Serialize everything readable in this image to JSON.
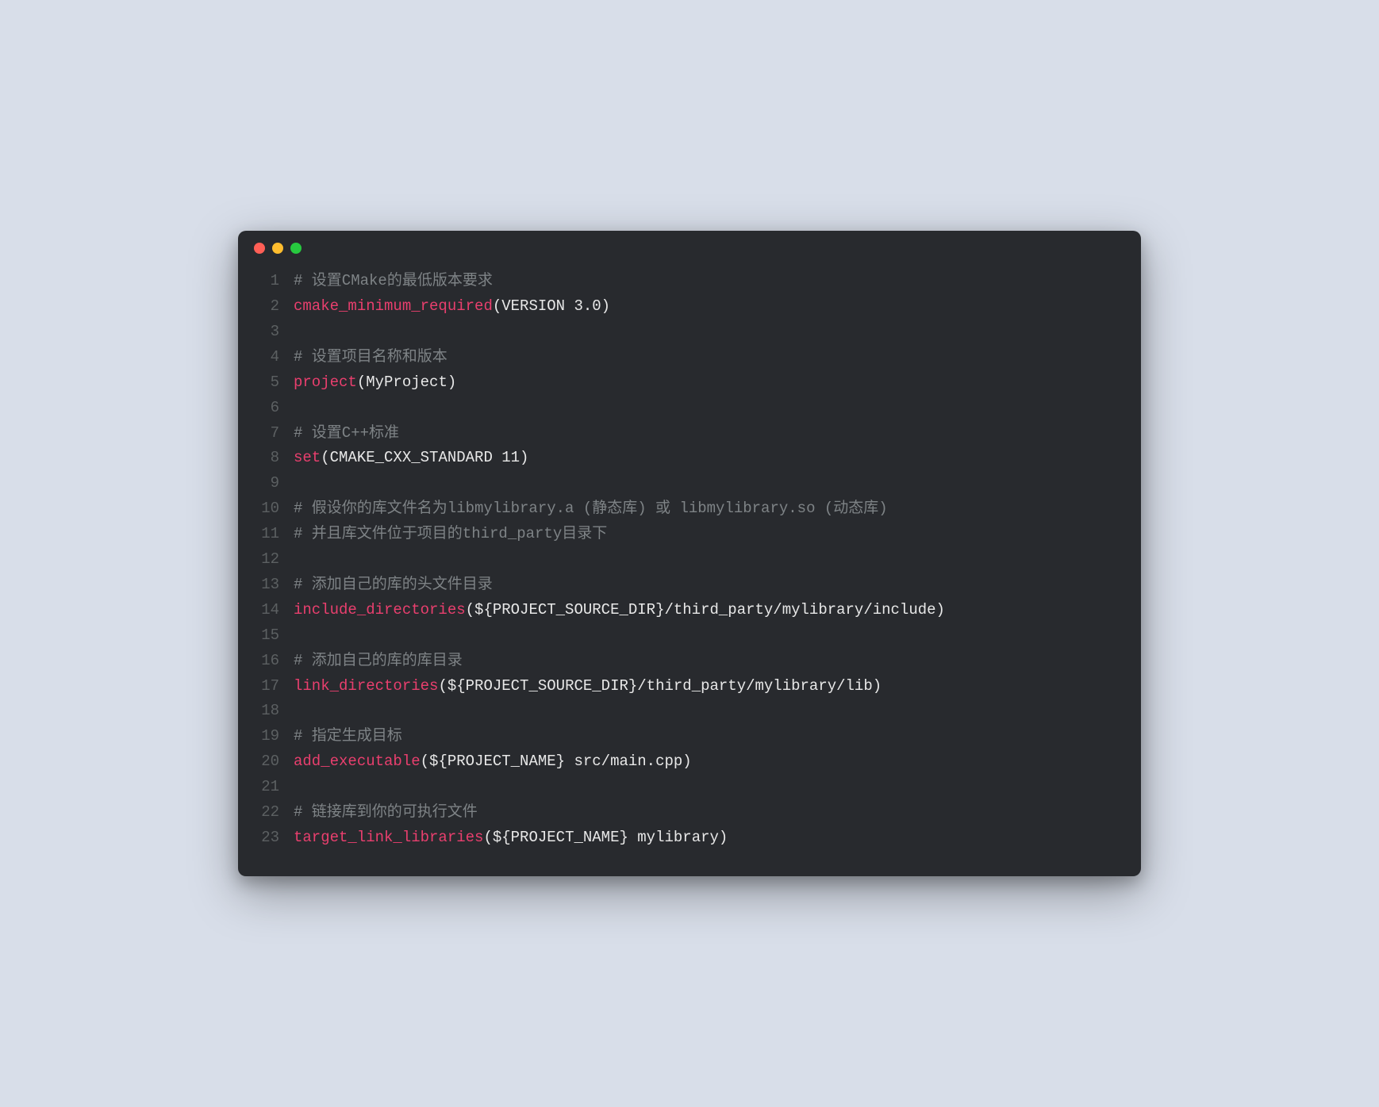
{
  "code": {
    "lines": [
      {
        "num": "1",
        "tokens": [
          {
            "cls": "tok-comment",
            "t": "# 设置CMake的最低版本要求"
          }
        ]
      },
      {
        "num": "2",
        "tokens": [
          {
            "cls": "tok-func",
            "t": "cmake_minimum_required"
          },
          {
            "cls": "tok-plain",
            "t": "(VERSION 3.0)"
          }
        ]
      },
      {
        "num": "3",
        "tokens": []
      },
      {
        "num": "4",
        "tokens": [
          {
            "cls": "tok-comment",
            "t": "# 设置项目名称和版本"
          }
        ]
      },
      {
        "num": "5",
        "tokens": [
          {
            "cls": "tok-func",
            "t": "project"
          },
          {
            "cls": "tok-plain",
            "t": "(MyProject)"
          }
        ]
      },
      {
        "num": "6",
        "tokens": []
      },
      {
        "num": "7",
        "tokens": [
          {
            "cls": "tok-comment",
            "t": "# 设置C++标准"
          }
        ]
      },
      {
        "num": "8",
        "tokens": [
          {
            "cls": "tok-func",
            "t": "set"
          },
          {
            "cls": "tok-plain",
            "t": "(CMAKE_CXX_STANDARD 11)"
          }
        ]
      },
      {
        "num": "9",
        "tokens": []
      },
      {
        "num": "10",
        "tokens": [
          {
            "cls": "tok-comment",
            "t": "# 假设你的库文件名为libmylibrary.a (静态库) 或 libmylibrary.so (动态库)"
          }
        ]
      },
      {
        "num": "11",
        "tokens": [
          {
            "cls": "tok-comment",
            "t": "# 并且库文件位于项目的third_party目录下"
          }
        ]
      },
      {
        "num": "12",
        "tokens": []
      },
      {
        "num": "13",
        "tokens": [
          {
            "cls": "tok-comment",
            "t": "# 添加自己的库的头文件目录"
          }
        ]
      },
      {
        "num": "14",
        "tokens": [
          {
            "cls": "tok-func",
            "t": "include_directories"
          },
          {
            "cls": "tok-plain",
            "t": "(${PROJECT_SOURCE_DIR}/third_party/mylibrary/include)"
          }
        ]
      },
      {
        "num": "15",
        "tokens": []
      },
      {
        "num": "16",
        "tokens": [
          {
            "cls": "tok-comment",
            "t": "# 添加自己的库的库目录"
          }
        ]
      },
      {
        "num": "17",
        "tokens": [
          {
            "cls": "tok-func",
            "t": "link_directories"
          },
          {
            "cls": "tok-plain",
            "t": "(${PROJECT_SOURCE_DIR}/third_party/mylibrary/lib)"
          }
        ]
      },
      {
        "num": "18",
        "tokens": []
      },
      {
        "num": "19",
        "tokens": [
          {
            "cls": "tok-comment",
            "t": "# 指定生成目标"
          }
        ]
      },
      {
        "num": "20",
        "tokens": [
          {
            "cls": "tok-func",
            "t": "add_executable"
          },
          {
            "cls": "tok-plain",
            "t": "(${PROJECT_NAME} src/main.cpp)"
          }
        ]
      },
      {
        "num": "21",
        "tokens": []
      },
      {
        "num": "22",
        "tokens": [
          {
            "cls": "tok-comment",
            "t": "# 链接库到你的可执行文件"
          }
        ]
      },
      {
        "num": "23",
        "tokens": [
          {
            "cls": "tok-func",
            "t": "target_link_libraries"
          },
          {
            "cls": "tok-plain",
            "t": "(${PROJECT_NAME} mylibrary)"
          }
        ]
      }
    ]
  }
}
